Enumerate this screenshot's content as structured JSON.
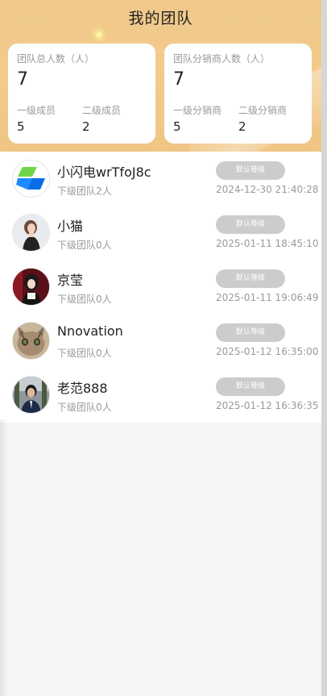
{
  "header": {
    "title": "我的团队"
  },
  "cards": [
    {
      "label": "团队总人数（人）",
      "total": "7",
      "sub1_label": "一级成员",
      "sub1_value": "5",
      "sub2_label": "二级成员",
      "sub2_value": "2"
    },
    {
      "label": "团队分销商人数（人）",
      "total": "7",
      "sub1_label": "一级分销商",
      "sub1_value": "5",
      "sub2_label": "二级分销商",
      "sub2_value": "2"
    }
  ],
  "members": [
    {
      "name": "小闪电wrTfoJ8c",
      "team": "下级团队2人",
      "level": "默认等级",
      "date": "2024-12-30 21:40:28",
      "avatar": "lightning-logo-icon"
    },
    {
      "name": "小猫",
      "team": "下级团队0人",
      "level": "默认等级",
      "date": "2025-01-11 18:45:10",
      "avatar": "woman-portrait-avatar"
    },
    {
      "name": "京莹",
      "team": "下级团队0人",
      "level": "默认等级",
      "date": "2025-01-11 19:06:49",
      "avatar": "woman-red-portrait-avatar"
    },
    {
      "name": "Nnovation",
      "team": "下级团队0人",
      "level": "默认等级",
      "date": "2025-01-12 16:35:00",
      "avatar": "cat-avatar"
    },
    {
      "name": "老范888",
      "team": "下级团队0人",
      "level": "默认等级",
      "date": "2025-01-12 16:36:35",
      "avatar": "man-portrait-avatar"
    }
  ]
}
